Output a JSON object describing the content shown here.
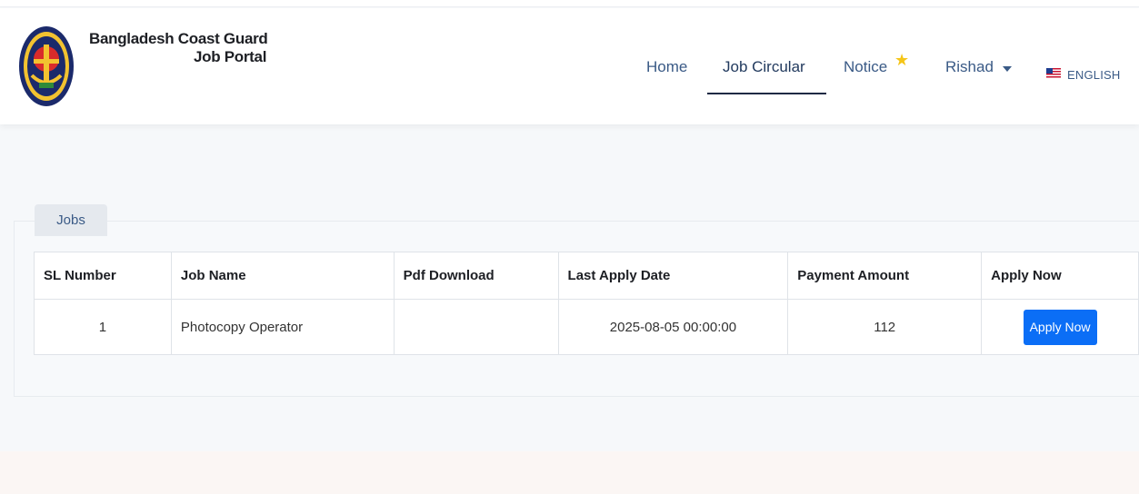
{
  "header": {
    "brand_line1": "Bangladesh Coast Guard",
    "brand_line2": "Job Portal",
    "logo_icon": "coast-guard-emblem-icon",
    "nav": [
      {
        "label": "Home"
      },
      {
        "label": "Job Circular",
        "active": true
      },
      {
        "label": "Notice",
        "icon": "star-icon"
      },
      {
        "label": "Rishad",
        "icon": "caret-down-icon"
      },
      {
        "label": "ENGLISH",
        "icon": "us-flag-icon"
      }
    ]
  },
  "jobs": {
    "tab_label": "Jobs",
    "columns": [
      "SL Number",
      "Job Name",
      "Pdf Download",
      "Last Apply Date",
      "Payment Amount",
      "Apply Now"
    ],
    "rows": [
      {
        "sl": "1",
        "job_name": "Photocopy Operator",
        "pdf": "",
        "last_apply_date": "2025-08-05 00:00:00",
        "payment_amount": "112",
        "apply_label": "Apply Now"
      }
    ]
  },
  "colors": {
    "accent": "#0b6ef6",
    "nav_text": "#3a5a86",
    "star": "#f5c518"
  }
}
